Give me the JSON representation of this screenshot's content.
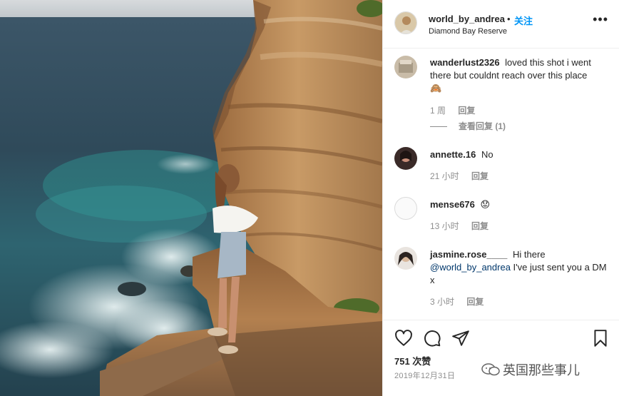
{
  "post": {
    "username": "world_by_andrea",
    "dot": "•",
    "follow_label": "关注",
    "location": "Diamond Bay Reserve",
    "more_icon": "more-horizontal-icon"
  },
  "comments": [
    {
      "username": "wanderlust2326",
      "text": "loved this shot i went there but couldnt reach over this place",
      "emoji": "🙈",
      "time": "1 周",
      "reply_label": "回复",
      "view_replies": "查看回复 (1)"
    },
    {
      "username": "annette.16",
      "text": "No",
      "time": "21 小时",
      "reply_label": "回复"
    },
    {
      "username": "mense676",
      "text": "😟",
      "time": "13 小时",
      "reply_label": "回复"
    },
    {
      "username": "jasmine.rose____",
      "text_before": "Hi there",
      "mention": "@world_by_andrea",
      "text_after": " I've just sent you a DM x",
      "time": "3 小时",
      "reply_label": "回复"
    }
  ],
  "actions": {
    "like_icon": "heart-icon",
    "comment_icon": "comment-icon",
    "share_icon": "share-icon",
    "save_icon": "bookmark-icon"
  },
  "likes": "751 次赞",
  "date": "2019年12月31日",
  "watermark": "英国那些事儿",
  "colors": {
    "follow": "#0095f6",
    "mention": "#00376b",
    "muted": "#8e8e8e",
    "text": "#262626"
  }
}
